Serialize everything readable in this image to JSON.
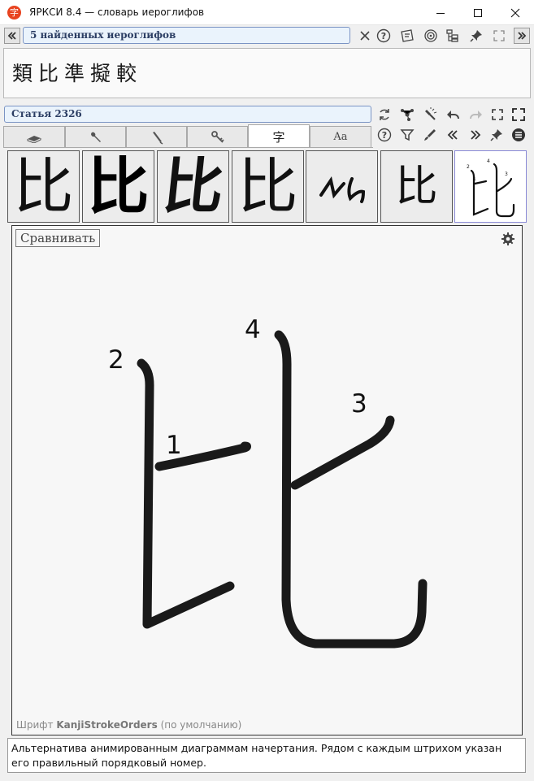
{
  "window": {
    "title": "ЯРКСИ 8.4 — словарь иероглифов",
    "app_icon_glyph": "字"
  },
  "search": {
    "results_label": "5 найденных иероглифов",
    "hits": [
      "類",
      "比",
      "準",
      "擬",
      "較"
    ]
  },
  "article": {
    "label": "Статья 2326"
  },
  "tabs": [
    {
      "name": "book-icon"
    },
    {
      "name": "wrench-icon"
    },
    {
      "name": "brush-icon"
    },
    {
      "name": "key-icon"
    },
    {
      "label": "字",
      "active": true
    },
    {
      "label": "Aa"
    }
  ],
  "glyph_variants": [
    {
      "glyph": "比",
      "style": "sans"
    },
    {
      "glyph": "比",
      "style": "sans-bold"
    },
    {
      "glyph": "比",
      "style": "brush"
    },
    {
      "glyph": "比",
      "style": "serif"
    },
    {
      "glyph": "比",
      "style": "cursive"
    },
    {
      "glyph": "比",
      "style": "light"
    },
    {
      "glyph": "比",
      "style": "stroke-order",
      "selected": true
    }
  ],
  "diagram": {
    "compare_label": "Сравнивать",
    "character": "比",
    "stroke_numbers": [
      "1",
      "2",
      "3",
      "4"
    ],
    "font_prefix": "Шрифт",
    "font_name": "KanjiStrokeOrders",
    "font_suffix": "(по умолчанию)"
  },
  "description": "Альтернатива анимированным диаграммам начертания. Рядом с каждым штрихом указан его правильный порядковый номер.",
  "colors": {
    "app_icon": "#e8431f",
    "field_bg": "#eaf3fc",
    "field_border": "#7b94c4",
    "field_text": "#2b3d63"
  }
}
